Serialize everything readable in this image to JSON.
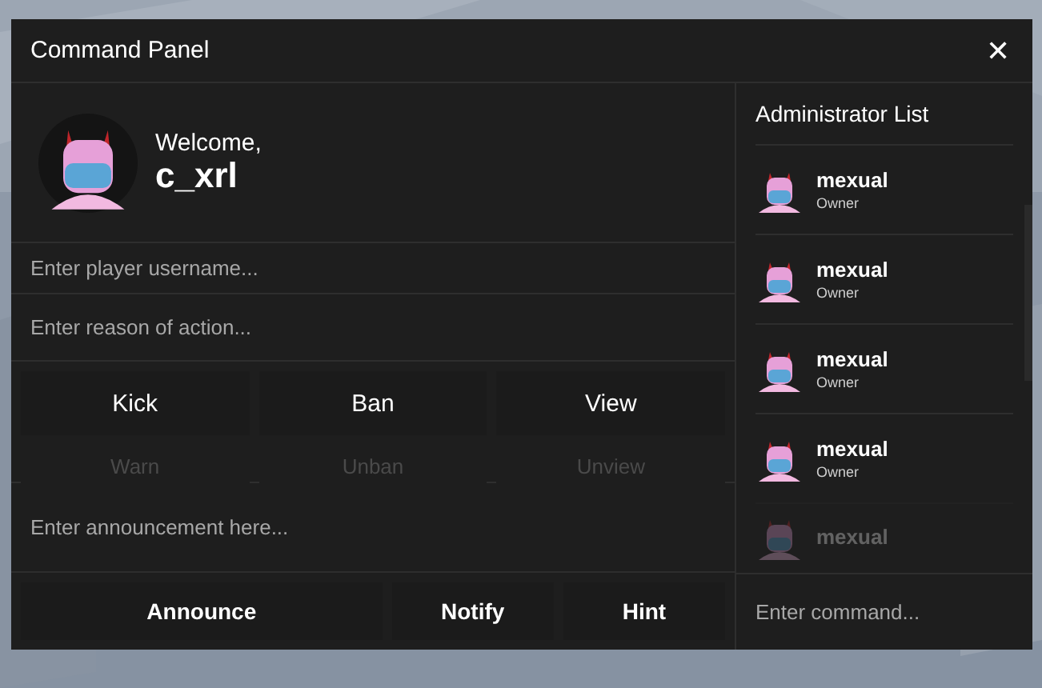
{
  "window": {
    "title": "Command Panel",
    "close": "✕"
  },
  "profile": {
    "greeting": "Welcome,",
    "username": "c_xrl"
  },
  "fields": [
    {
      "placeholder": "Enter player username..."
    },
    {
      "placeholder": "Enter reason of action..."
    }
  ],
  "actions": [
    {
      "label": "Kick",
      "faded": false
    },
    {
      "label": "Ban",
      "faded": false
    },
    {
      "label": "View",
      "faded": false
    },
    {
      "label": "Warn",
      "faded": true
    },
    {
      "label": "Unban",
      "faded": true
    },
    {
      "label": "Unview",
      "faded": true
    }
  ],
  "announcement": {
    "placeholder": "Enter announcement here..."
  },
  "broadcast_buttons": [
    {
      "label": "Announce"
    },
    {
      "label": "Notify"
    },
    {
      "label": "Hint"
    }
  ],
  "admin_list": {
    "title": "Administrator List",
    "items": [
      {
        "name": "mexual",
        "role": "Owner",
        "faded": false
      },
      {
        "name": "mexual",
        "role": "Owner",
        "faded": false
      },
      {
        "name": "mexual",
        "role": "Owner",
        "faded": false
      },
      {
        "name": "mexual",
        "role": "Owner",
        "faded": false
      },
      {
        "name": "mexual",
        "faded": true
      }
    ]
  },
  "command": {
    "placeholder": "Enter command..."
  }
}
